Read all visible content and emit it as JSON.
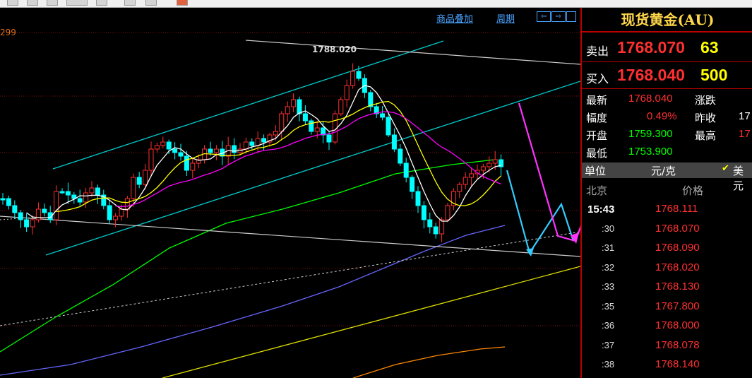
{
  "chart": {
    "overlay_link": "商品叠加",
    "period_link": "周期",
    "nav_left": "⇦",
    "nav_right": "⇨",
    "y_axis_partial": "299",
    "peak_marker": "1788.020"
  },
  "quote": {
    "title": "现货黄金(AU)",
    "sell_label": "卖出",
    "sell_price": "1768.070",
    "sell_volume": "63",
    "buy_label": "买入",
    "buy_price": "1768.040",
    "buy_volume": "500",
    "stats": {
      "latest_label": "最新",
      "latest_value": "1768.040",
      "change_label": "涨跌",
      "range_label": "幅度",
      "range_value": "0.49%",
      "prev_close_label": "昨收",
      "prev_close_value": "17",
      "open_label": "开盘",
      "open_value": "1759.300",
      "high_label": "最高",
      "high_value": "17",
      "low_label": "最低",
      "low_value": "1753.900"
    },
    "unit_label": "单位",
    "unit_value": "元/克",
    "currency_check": "✔",
    "currency_label": "美元",
    "ticks_header_location": "北京",
    "ticks_header_price": "价格",
    "ticks": [
      {
        "time": "15:43",
        "price": "1768.111"
      },
      {
        "time": ":30",
        "price": "1768.070"
      },
      {
        "time": ":31",
        "price": "1768.090"
      },
      {
        "time": ":32",
        "price": "1768.020"
      },
      {
        "time": ":33",
        "price": "1768.130"
      },
      {
        "time": ":35",
        "price": "1767.800"
      },
      {
        "time": ":36",
        "price": "1768.000"
      },
      {
        "time": ":37",
        "price": "1768.078"
      },
      {
        "time": ":38",
        "price": "1768.140"
      }
    ]
  },
  "colors": {
    "up": "#ff3030",
    "down": "#00ffff",
    "ma5": "#ffffff",
    "ma10": "#ffff00",
    "ma20": "#ff00ff",
    "ma60": "#00ff00",
    "ma120": "#6666ff",
    "ma250": "#ff8800",
    "channel": "#00cccc",
    "forecast_cyan": "#33ccff",
    "forecast_magenta": "#ff33ff"
  }
}
